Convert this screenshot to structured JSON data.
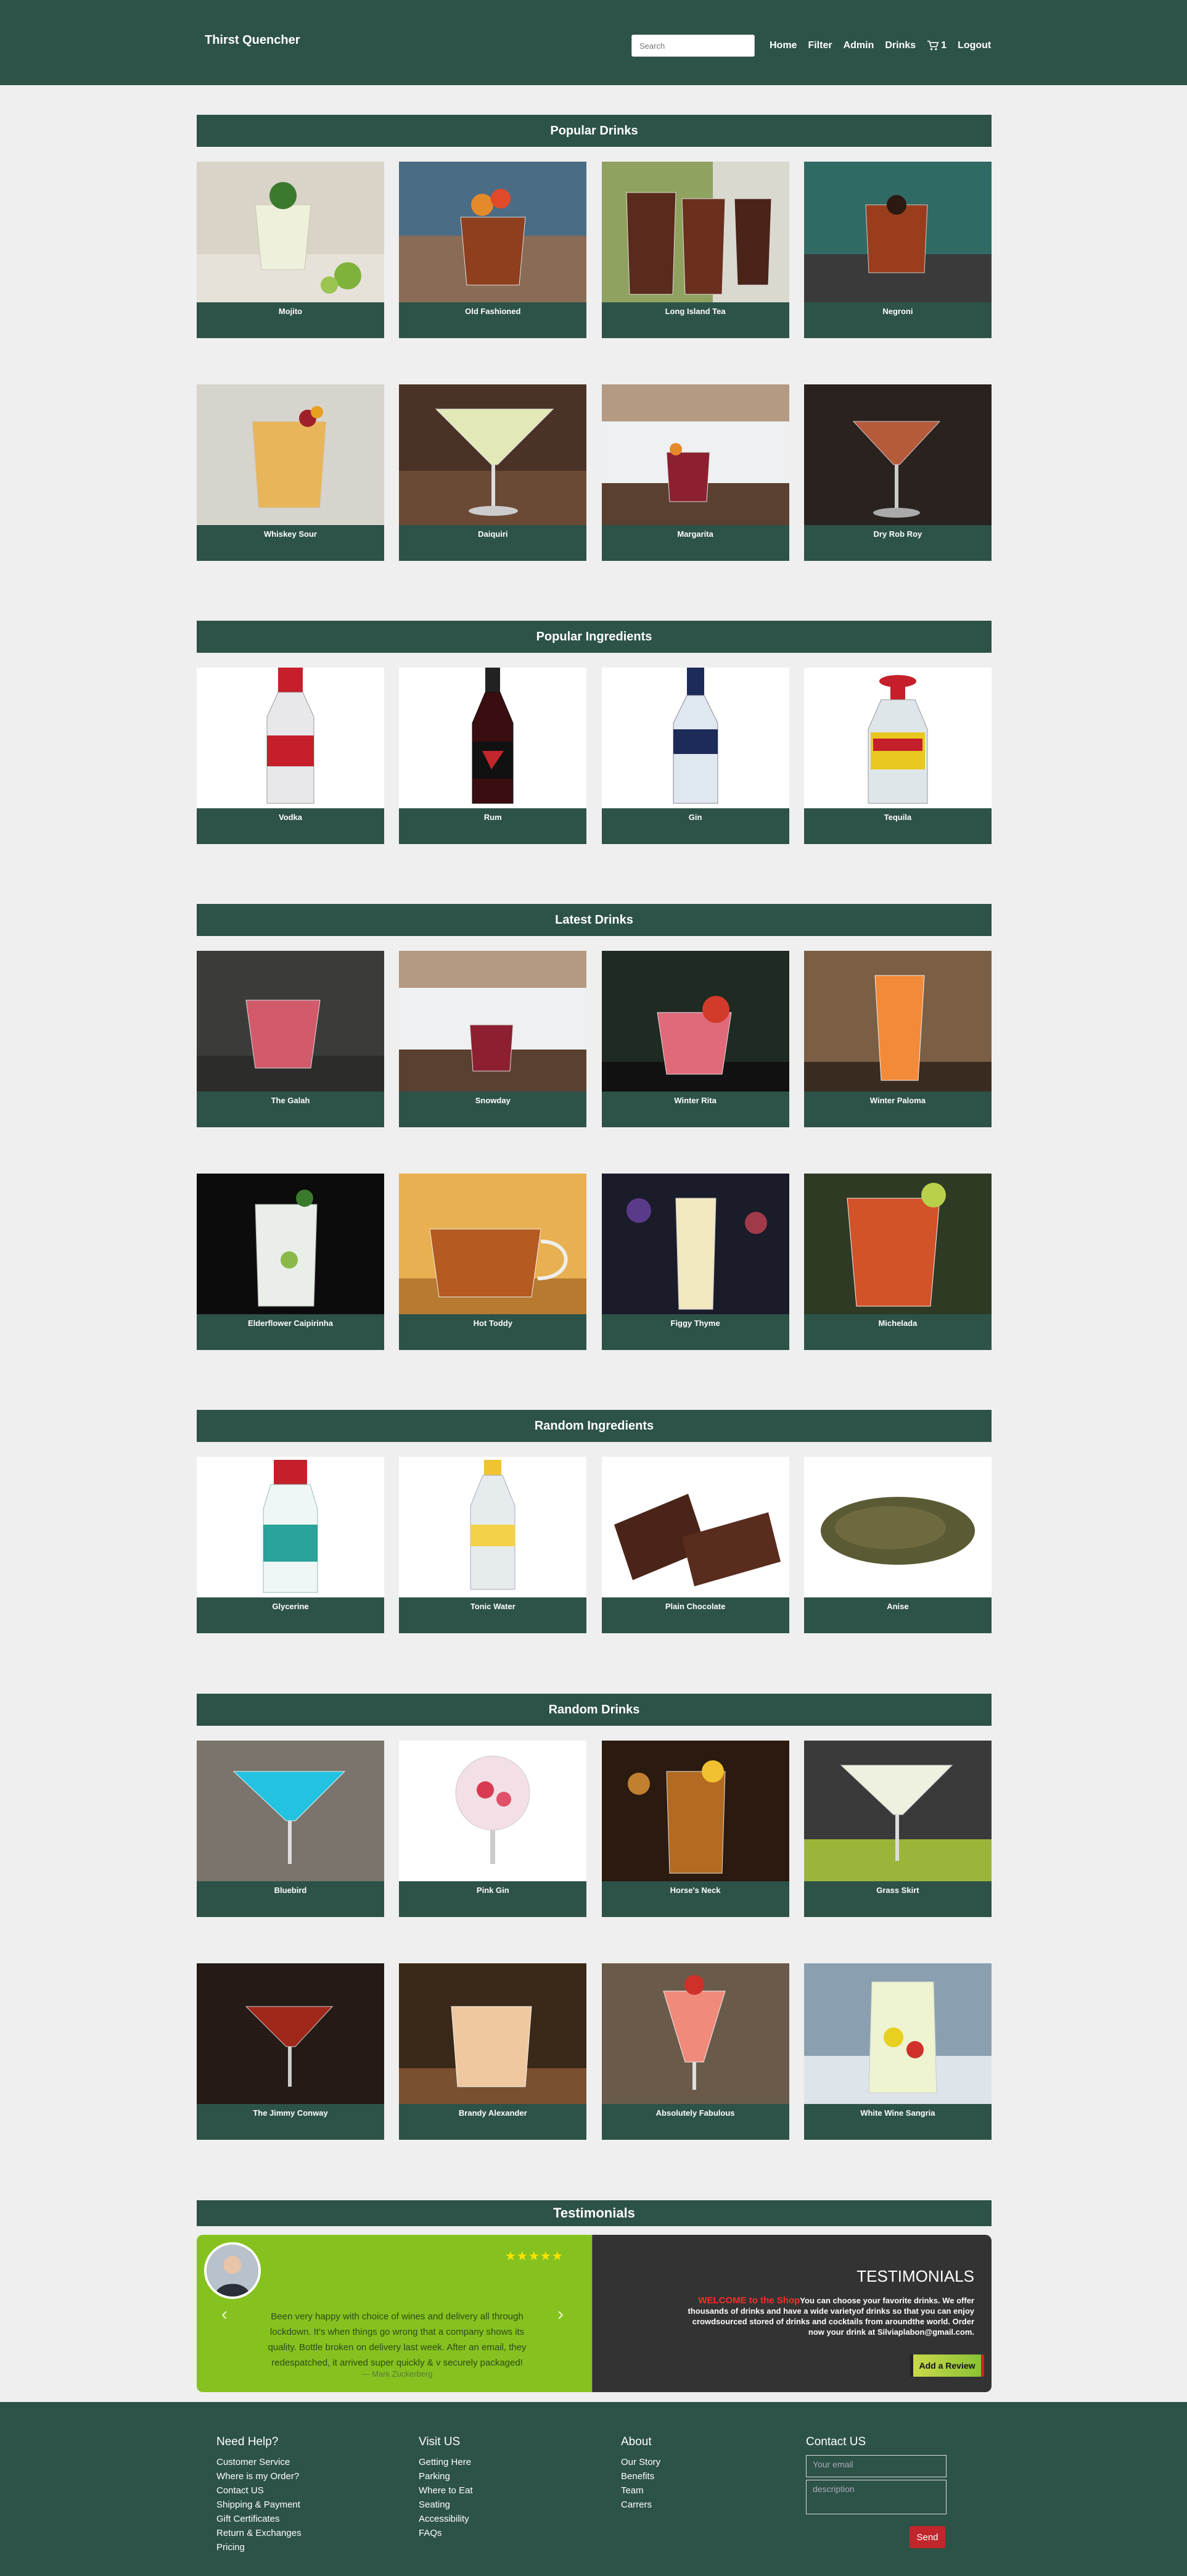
{
  "header": {
    "brand": "Thirst Quencher",
    "search_placeholder": "Search",
    "nav": {
      "home": "Home",
      "filter": "Filter",
      "admin": "Admin",
      "drinks": "Drinks",
      "cart_count": "1",
      "logout": "Logout"
    }
  },
  "sections": {
    "popular_drinks": {
      "title": "Popular Drinks",
      "items": [
        "Mojito",
        "Old Fashioned",
        "Long Island Tea",
        "Negroni",
        "Whiskey Sour",
        "Daiquiri",
        "Margarita",
        "Dry Rob Roy"
      ]
    },
    "popular_ingredients": {
      "title": "Popular Ingredients",
      "items": [
        "Vodka",
        "Rum",
        "Gin",
        "Tequila"
      ]
    },
    "latest_drinks": {
      "title": "Latest Drinks",
      "items": [
        "The Galah",
        "Snowday",
        "Winter Rita",
        "Winter Paloma",
        "Elderflower Caipirinha",
        "Hot Toddy",
        "Figgy Thyme",
        "Michelada"
      ]
    },
    "random_ingredients": {
      "title": "Random Ingredients",
      "items": [
        "Glycerine",
        "Tonic Water",
        "Plain Chocolate",
        "Anise"
      ]
    },
    "random_drinks": {
      "title": "Random Drinks",
      "items": [
        "Bluebird",
        "Pink Gin",
        "Horse's Neck",
        "Grass Skirt",
        "The Jimmy Conway",
        "Brandy Alexander",
        "Absolutely Fabulous",
        "White Wine Sangria"
      ]
    },
    "testimonials": {
      "title": "Testimonials"
    }
  },
  "testimonial": {
    "rating": 5,
    "stars": "★★★★★",
    "quote": "Been very happy with choice of wines and delivery all through lockdown. It's when things go wrong that a company shows its quality. Bottle broken on delivery last week. After an email, they redespatched, it arrived super quickly & v securely packaged!",
    "author": "— Mark Zuckerberg",
    "heading": "TESTIMONIALS",
    "welcome": "WELCOME to the Shop",
    "text": "You can choose your favorite drinks. We offer thousands of drinks and have a wide varietyof drinks so that you can enjoy crowdsourced stored of drinks and cocktails from aroundthe world. Order now your drink at Silviaplabon@gmail.com.",
    "button": "Add a Review"
  },
  "footer": {
    "help": {
      "title": "Need Help?",
      "links": [
        "Customer Service",
        "Where is my Order?",
        "Contact US",
        "Shipping & Payment",
        "Gift Certificates",
        "Return & Exchanges",
        "Pricing"
      ]
    },
    "visit": {
      "title": "Visit US",
      "links": [
        "Getting Here",
        "Parking",
        "Where to Eat",
        "Seating",
        "Accessibility",
        "FAQs"
      ]
    },
    "about": {
      "title": "About",
      "links": [
        "Our Story",
        "Benefits",
        "Team",
        "Carrers"
      ]
    },
    "contact": {
      "title": "Contact US",
      "email_placeholder": "Your email",
      "description_placeholder": "description",
      "send": "Send"
    }
  },
  "colors": {
    "primary": "#2d5248",
    "background": "#efefef",
    "testimonial_green": "#86c21f",
    "testimonial_dark": "#333333",
    "send_red": "#c0262b",
    "stars": "#ffe400"
  }
}
